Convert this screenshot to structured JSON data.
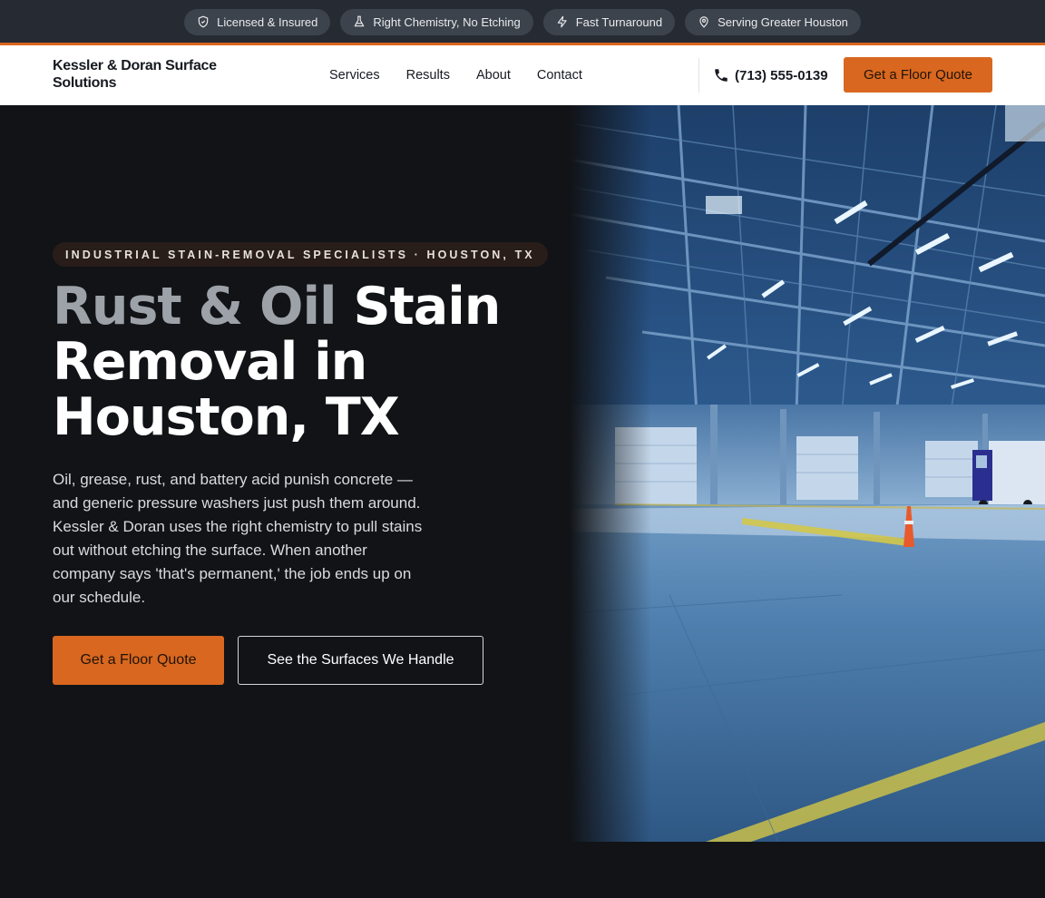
{
  "topbar": {
    "badges": [
      {
        "label": "Licensed & Insured",
        "icon": "shield-icon"
      },
      {
        "label": "Right Chemistry, No Etching",
        "icon": "flask-icon"
      },
      {
        "label": "Fast Turnaround",
        "icon": "lightning-icon"
      },
      {
        "label": "Serving Greater Houston",
        "icon": "map-pin-icon"
      }
    ],
    "accent_color": "#d9671f"
  },
  "nav": {
    "brand": "Kessler & Doran Surface Solutions",
    "links": [
      "Services",
      "Results",
      "About",
      "Contact"
    ],
    "phone": "(713) 555-0139",
    "cta": "Get a Floor Quote"
  },
  "hero": {
    "kicker": "INDUSTRIAL STAIN-REMOVAL SPECIALISTS · HOUSTON, TX",
    "headline_muted": "Rust & Oil",
    "headline_main": "Stain Removal in Houston, TX",
    "body": "Oil, grease, rust, and battery acid punish concrete — and generic pressure washers just push them around. Kessler & Doran uses the right chemistry to pull stains out without etching the surface. When another company says 'that's permanent,' the job ends up on our schedule.",
    "primary_cta": "Get a Floor Quote",
    "secondary_cta": "See the Surfaces We Handle",
    "image": "warehouse-floor-photo"
  },
  "colors": {
    "brand_orange": "#d9671f",
    "dark_background": "#111317",
    "topbar_background": "#262b33"
  }
}
